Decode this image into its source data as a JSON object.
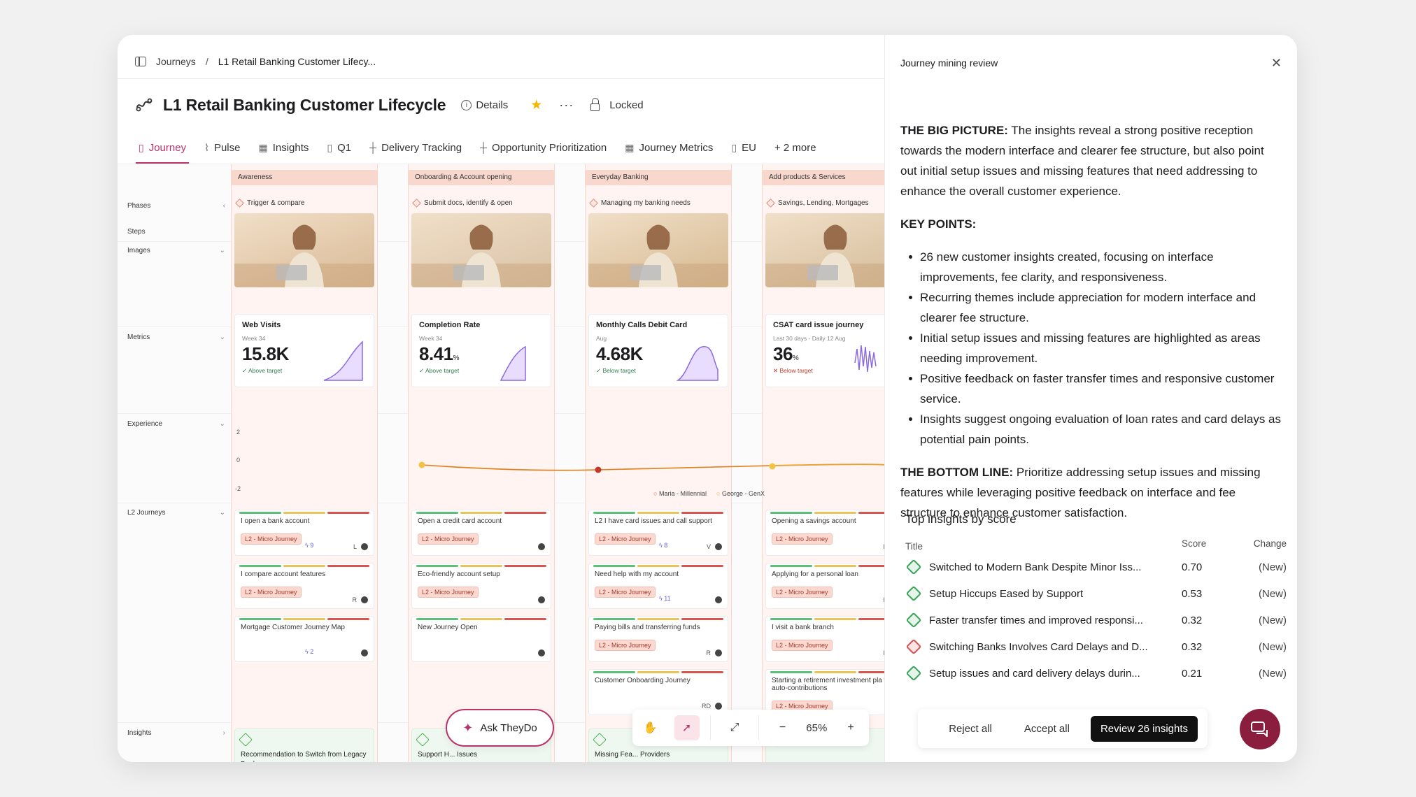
{
  "breadcrumb": {
    "root": "Journeys",
    "sep": "/",
    "current": "L1 Retail Banking Customer Lifecy..."
  },
  "header": {
    "title": "L1 Retail Banking Customer Lifecycle",
    "details": "Details",
    "locked": "Locked"
  },
  "tabs": [
    {
      "label": "Journey",
      "icon": "map-icon"
    },
    {
      "label": "Pulse",
      "icon": "pulse-icon"
    },
    {
      "label": "Insights",
      "icon": "table-icon"
    },
    {
      "label": "Q1",
      "icon": "map-icon"
    },
    {
      "label": "Delivery Tracking",
      "icon": "grid-icon"
    },
    {
      "label": "Opportunity Prioritization",
      "icon": "grid-icon"
    },
    {
      "label": "Journey Metrics",
      "icon": "table-icon"
    },
    {
      "label": "EU",
      "icon": "map-icon"
    },
    {
      "label": "+ 2 more",
      "icon": ""
    }
  ],
  "rows": {
    "phases": "Phases",
    "steps": "Steps",
    "images": "Images",
    "metrics": "Metrics",
    "experience": "Experience",
    "l2": "L2 Journeys",
    "insights": "Insights"
  },
  "experience_axis": {
    "top": "2",
    "mid": "0",
    "bot": "-2",
    "legend": [
      "Maria - Millennial",
      "George - GenX"
    ]
  },
  "columns": [
    {
      "phase": "Awareness",
      "step": "Trigger & compare",
      "metric": {
        "title": "Web Visits",
        "sub": "Week 34",
        "value": "15.8K",
        "unit": "",
        "note": "Above target",
        "status": "ok"
      },
      "l2": [
        {
          "title": "I open a bank account",
          "tag": "L2 - Micro Journey",
          "count": "9",
          "extra": "L"
        },
        {
          "title": "I compare account features",
          "tag": "L2 - Micro Journey",
          "count": "",
          "extra": "R"
        },
        {
          "title": "Mortgage Customer Journey Map",
          "tag": "",
          "count": "2",
          "extra": ""
        }
      ],
      "insight": {
        "title": "Recommendation to Switch from Legacy Banks"
      }
    },
    {
      "phase": "Onboarding & Account opening",
      "step": "Submit docs, identify & open",
      "metric": {
        "title": "Completion Rate",
        "sub": "Week 34",
        "value": "8.41",
        "unit": "%",
        "note": "Above target",
        "status": "ok"
      },
      "l2": [
        {
          "title": "Open a credit card account",
          "tag": "L2 - Micro Journey",
          "count": "",
          "extra": ""
        },
        {
          "title": "Eco-friendly account setup",
          "tag": "L2 - Micro Journey",
          "count": "",
          "extra": ""
        },
        {
          "title": "New Journey Open",
          "tag": "",
          "count": "",
          "extra": ""
        }
      ],
      "insight": {
        "title": "Support H... Issues"
      }
    },
    {
      "phase": "Everyday Banking",
      "step": "Managing my banking needs",
      "metric": {
        "title": "Monthly Calls Debit Card",
        "sub": "Aug",
        "value": "4.68K",
        "unit": "",
        "note": "Below target",
        "status": "ok"
      },
      "l2": [
        {
          "title": "L2 I have card issues and call support",
          "tag": "L2 - Micro Journey",
          "count": "8",
          "extra": "V"
        },
        {
          "title": "Need help with my account",
          "tag": "L2 - Micro Journey",
          "count": "11",
          "extra": ""
        },
        {
          "title": "Paying bills and transferring funds",
          "tag": "L2 - Micro Journey",
          "count": "",
          "extra": "R"
        },
        {
          "title": "Customer Onboarding Journey",
          "tag": "",
          "count": "",
          "extra": "RD"
        }
      ],
      "insight": {
        "title": "Missing Fea... Providers"
      }
    },
    {
      "phase": "Add products & Services",
      "step": "Savings, Lending, Mortgages",
      "metric": {
        "title": "CSAT card issue journey",
        "sub": "Last 30 days - Daily 12 Aug",
        "value": "36",
        "unit": "%",
        "note": "Below target",
        "status": "bad"
      },
      "l2": [
        {
          "title": "Opening a savings account",
          "tag": "L2 - Micro Journey",
          "count": "",
          "extra": "R"
        },
        {
          "title": "Applying for a personal loan",
          "tag": "L2 - Micro Journey",
          "count": "",
          "extra": "R"
        },
        {
          "title": "I visit a bank branch",
          "tag": "L2 - Micro Journey",
          "count": "",
          "extra": "R"
        },
        {
          "title": "Starting a retirement investment pla with auto-contributions",
          "tag": "L2 - Micro Journey",
          "count": "",
          "extra": ""
        }
      ],
      "insight": {
        "title": ""
      }
    }
  ],
  "toolbar": {
    "ask": "Ask TheyDo",
    "zoom": "65%"
  },
  "panel": {
    "title": "Journey mining review",
    "big_picture_label": "THE BIG PICTURE:",
    "big_picture": " The insights reveal a strong positive reception towards the modern interface and clearer fee structure, but also point out initial setup issues and missing features that need addressing to enhance the overall customer experience.",
    "key_points_label": "KEY POINTS:",
    "key_points": [
      "26 new customer insights created, focusing on interface improvements, fee clarity, and responsiveness.",
      "Recurring themes include appreciation for modern interface and clearer fee structure.",
      "Initial setup issues and missing features are highlighted as areas needing improvement.",
      "Positive feedback on faster transfer times and responsive customer service.",
      "Insights suggest ongoing evaluation of loan rates and card delays as potential pain points."
    ],
    "bottom_line_label": "THE BOTTOM LINE:",
    "bottom_line": " Prioritize addressing setup issues and missing features while leveraging positive feedback on interface and fee structure to enhance customer satisfaction.",
    "top_insights_title": "Top insights by score",
    "table_headers": {
      "title": "Title",
      "score": "Score",
      "change": "Change"
    },
    "insights": [
      {
        "title": "Switched to Modern Bank Despite Minor Iss...",
        "score": "0.70",
        "change": "(New)",
        "sentiment": "positive"
      },
      {
        "title": "Setup Hiccups Eased by Support",
        "score": "0.53",
        "change": "(New)",
        "sentiment": "positive"
      },
      {
        "title": "Faster transfer times and improved responsi...",
        "score": "0.32",
        "change": "(New)",
        "sentiment": "positive"
      },
      {
        "title": "Switching Banks Involves Card Delays and D...",
        "score": "0.32",
        "change": "(New)",
        "sentiment": "negative"
      },
      {
        "title": "Setup issues and card delivery delays durin...",
        "score": "0.21",
        "change": "(New)",
        "sentiment": "positive"
      }
    ],
    "actions": {
      "reject": "Reject all",
      "accept": "Accept all",
      "review": "Review 26 insights"
    }
  }
}
